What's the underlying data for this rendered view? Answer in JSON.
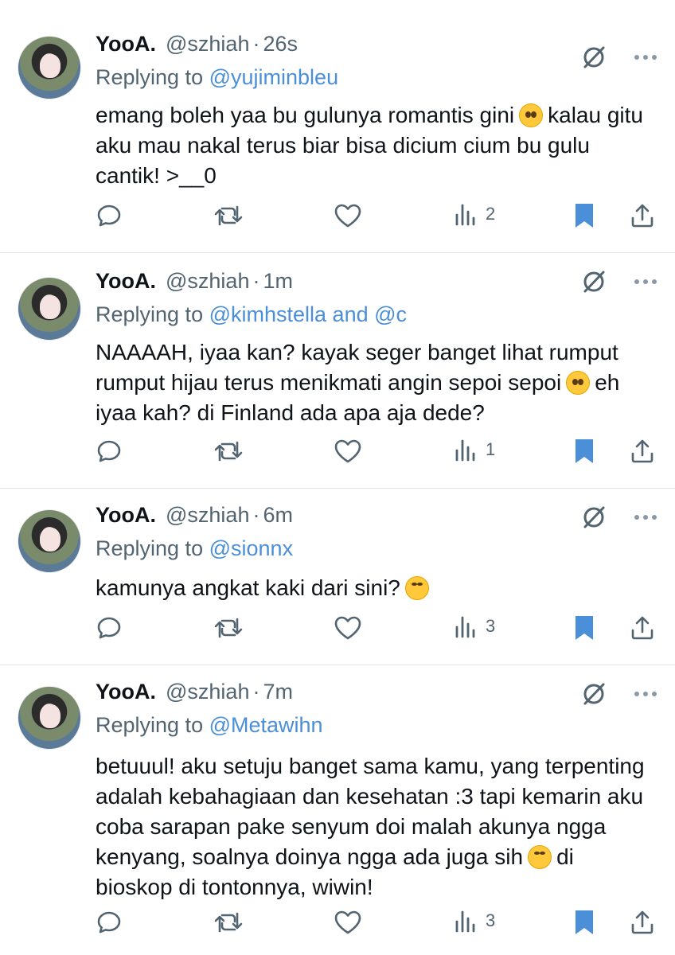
{
  "tweets": [
    {
      "name": "YooA.",
      "handle": "@szhiah",
      "time": "26s",
      "replying_prefix": "Replying to",
      "replying_to": "@yujiminbleu",
      "text_parts": [
        "emang boleh yaa bu gulunya romantis gini",
        "kalau gitu aku mau nakal terus biar bisa dicium cium bu gulu cantik! >__0"
      ],
      "emoji": "pleading-face-emoji",
      "views": "2"
    },
    {
      "name": "YooA.",
      "handle": "@szhiah",
      "time": "1m",
      "replying_prefix": "Replying to",
      "replying_to": "@kimhstella and @c",
      "text_parts": [
        "NAAAAH, iyaa kan? kayak seger banget lihat rumput rumput hijau terus menikmati angin sepoi sepoi",
        "eh iyaa kah? di Finland ada apa aja dede?"
      ],
      "emoji": "pleading-face-emoji",
      "views": "1"
    },
    {
      "name": "YooA.",
      "handle": "@szhiah",
      "time": "6m",
      "replying_prefix": "Replying to",
      "replying_to": "@sionnx",
      "text_parts": [
        "kamunya angkat kaki dari sini?",
        ""
      ],
      "emoji": "loudly-crying-face-emoji",
      "views": "3"
    },
    {
      "name": "YooA.",
      "handle": "@szhiah",
      "time": "7m",
      "replying_prefix": "Replying to",
      "replying_to": "@Metawihn",
      "text_parts": [
        "betuuul! aku setuju banget sama kamu, yang terpenting adalah kebahagiaan dan kesehatan :3 tapi kemarin aku coba sarapan pake senyum doi malah akunya ngga kenyang, soalnya doinya ngga ada juga sih",
        "di bioskop di tontonnya, wiwin!"
      ],
      "emoji": "loudly-crying-face-emoji",
      "views": "3"
    }
  ],
  "colors": {
    "accent": "#4a8fd8",
    "secondary_text": "#536471",
    "bookmark": "#4a8fd8",
    "divider": "#e1e4e8"
  }
}
